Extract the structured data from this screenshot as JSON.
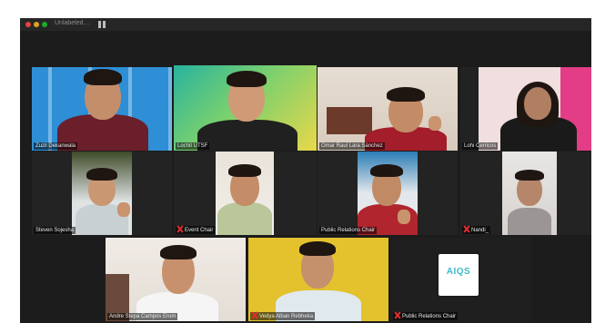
{
  "window": {
    "title": "Unlabeled…"
  },
  "participants": [
    {
      "name": "Zuzil Dekanwala",
      "muted": false
    },
    {
      "name": "Lochit UTSF",
      "muted": false
    },
    {
      "name": "Omar Raul Lara Sánchez",
      "muted": false
    },
    {
      "name": "Lohi Cerricos",
      "muted": false
    },
    {
      "name": "Steven Sojesha",
      "muted": false
    },
    {
      "name": "Event Chair",
      "muted": true
    },
    {
      "name": "Public Relations Chair",
      "muted": false
    },
    {
      "name": "Nandi_",
      "muted": true
    },
    {
      "name": "Andre Stepa Campos Erum",
      "muted": false
    },
    {
      "name": "Vedya Alban Rebheka",
      "muted": true
    },
    {
      "name": "Public Relations Chair",
      "muted": true
    }
  ],
  "logo": {
    "text": "AIQS",
    "color": "#3db9c9"
  },
  "colors": {
    "background": "#1c1c1c",
    "active_speaker_border": "#c8c94a",
    "muted_icon": "#e22d2d"
  }
}
